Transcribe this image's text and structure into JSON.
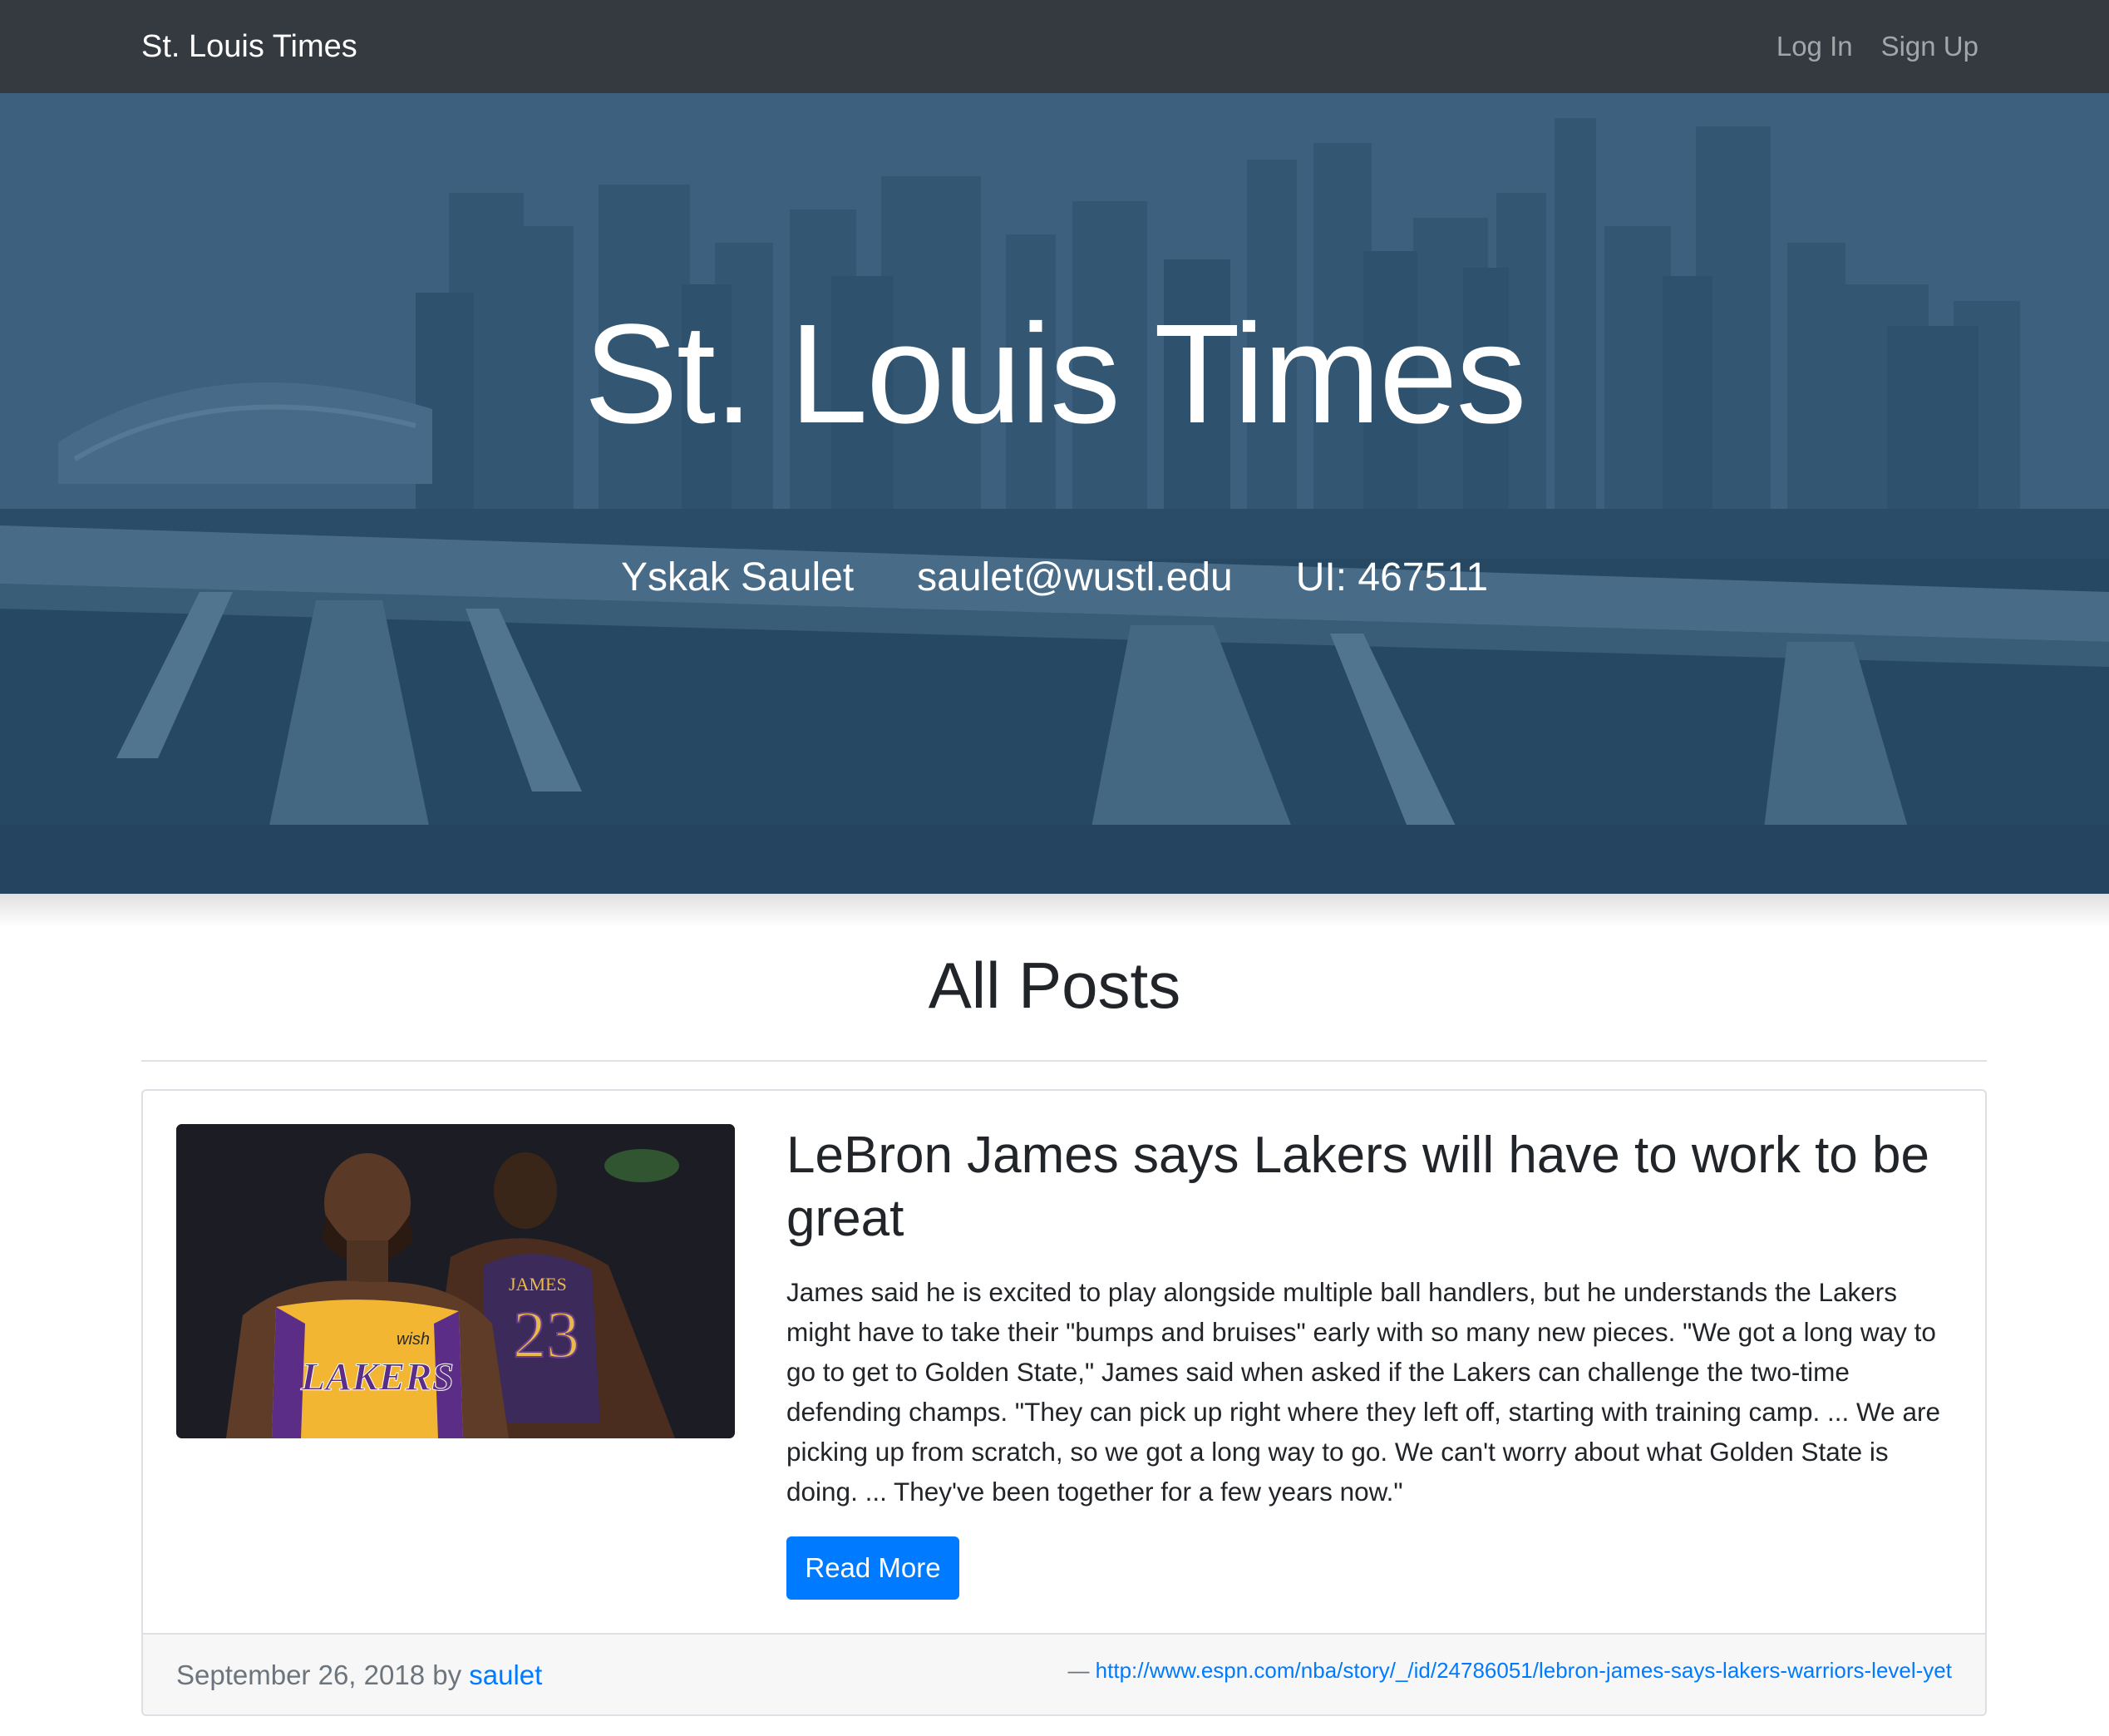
{
  "navbar": {
    "brand": "St. Louis Times",
    "links": [
      "Log In",
      "Sign Up"
    ]
  },
  "hero": {
    "title": "St. Louis Times",
    "author_name": "Yskak Saulet",
    "author_email": "saulet@wustl.edu",
    "ui_id": "UI: 467511"
  },
  "posts_section": {
    "heading": "All Posts"
  },
  "post": {
    "title": "LeBron James says Lakers will have to work to be great",
    "excerpt": "James said he is excited to play alongside multiple ball handlers, but he understands the Lakers might have to take their \"bumps and bruises\" early with so many new pieces. \"We got a long way to go to get to Golden State,\" James said when asked if the Lakers can challenge the two-time defending champs. \"They can pick up right where they left off, starting with training camp. ... We are picking up from scratch, so we got a long way to go. We can't worry about what Golden State is doing. ... They've been together for a few years now.\"",
    "read_more": "Read More",
    "date_by": "September 26, 2018 by ",
    "author": "saulet",
    "source_dash": "— ",
    "source_url": "http://www.espn.com/nba/story/_/id/24786051/lebron-james-says-lakers-warriors-level-yet",
    "image": {
      "jersey_brand": "LAKERS",
      "back_name": "JAMES",
      "back_number": "23",
      "sponsor": "wish"
    }
  },
  "colors": {
    "navbar_bg": "#343a40",
    "primary": "#007bff",
    "hero_tint": "#3a5c75"
  }
}
